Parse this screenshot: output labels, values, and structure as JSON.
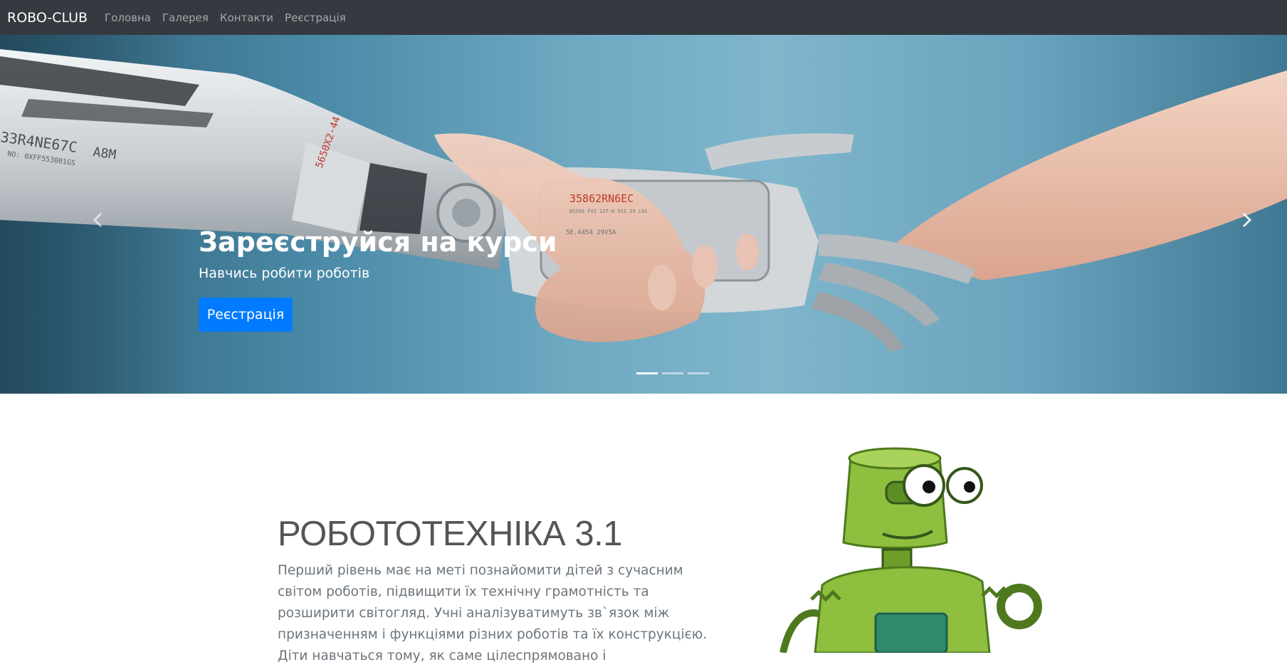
{
  "navbar": {
    "brand": "ROBO-CLUB",
    "links": [
      "Головна",
      "Галерея",
      "Контакти",
      "Реєстрація"
    ]
  },
  "carousel": {
    "title": "Зареєструйся на курси",
    "subtitle": "Навчись робити роботів",
    "button_label": "Реєстрація",
    "active_slide": 1,
    "slide_count": 3,
    "image_text": {
      "arm_code": "33R4NE67C",
      "arm_model": "A8M",
      "arm_no": "NO: 0XFF553001GS",
      "arm_side": "5650X2-44",
      "hand_code": "35862RN6EC",
      "hand_small": "BS556 FX2 137-H 5S3 29 L6S",
      "hand_ref": "5E.4454 29V5A"
    }
  },
  "section": {
    "title": "РОБОТОТЕХНІКА 3.1",
    "text": "Перший рівень має на меті познайомити дітей з сучасним світом роботів, підвищити їх технічну грамотність та розширити світогляд. Учні аналізуватимуть зв`язок між призначенням і функціями різних роботів та їх конструкцією. Діти навчаться тому, як саме цілеспрямовано і"
  },
  "colors": {
    "navbar_bg": "#343a40",
    "primary": "#007bff",
    "sky": "#6fa9c2",
    "robot_green": "#7fae3a"
  }
}
